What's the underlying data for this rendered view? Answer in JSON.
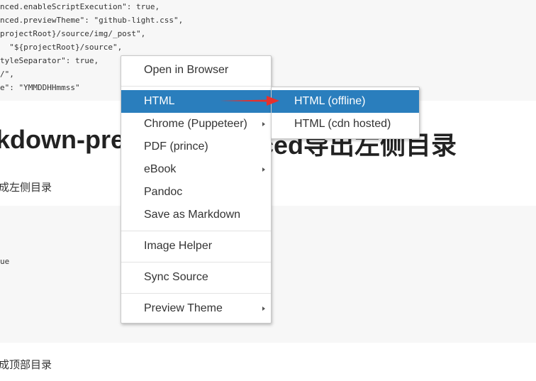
{
  "code_top": [
    "nced.enableScriptExecution\": true,",
    "nced.previewTheme\": \"github-light.css\",",
    "projectRoot}/source/img/_post\",",
    "  \"${projectRoot}/source\",",
    "tyleSeparator\": true,",
    "/\",",
    "e\": \"YMMDDHHmmss\""
  ],
  "heading": "kdown-pre",
  "heading_right": "ced导出左侧目录",
  "para1": "成左侧目录",
  "code_mid_line": "ue",
  "para2": "成顶部目录",
  "menu": {
    "items": [
      {
        "label": "Open in Browser"
      },
      {
        "label": "HTML"
      },
      {
        "label": "Chrome (Puppeteer)"
      },
      {
        "label": "PDF (prince)"
      },
      {
        "label": "eBook"
      },
      {
        "label": "Pandoc"
      },
      {
        "label": "Save as Markdown"
      },
      {
        "label": "Image Helper"
      },
      {
        "label": "Sync Source"
      },
      {
        "label": "Preview Theme"
      }
    ]
  },
  "submenu": {
    "items": [
      {
        "label": "HTML (offline)"
      },
      {
        "label": "HTML (cdn hosted)"
      }
    ]
  },
  "colors": {
    "active": "#2a7ebd",
    "arrow": "#e8302b"
  }
}
